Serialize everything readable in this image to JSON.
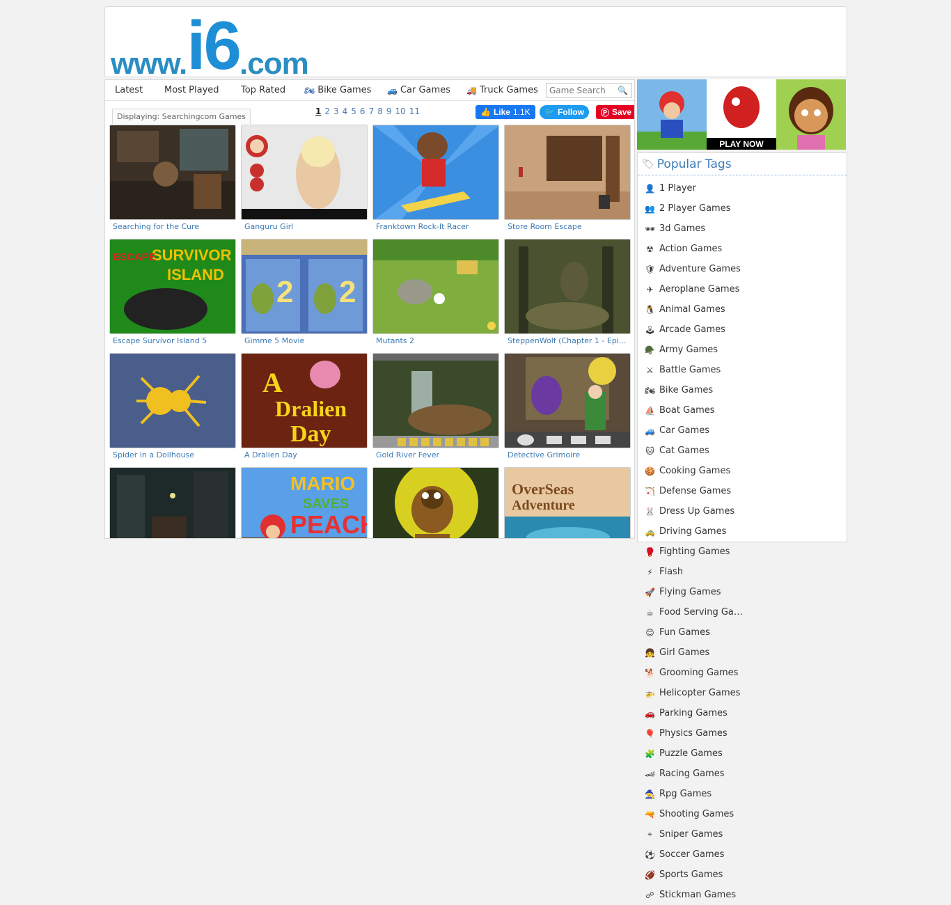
{
  "logo": {
    "www": "www.",
    "i6": "i6",
    "com": ".com"
  },
  "nav": {
    "latest": "Latest",
    "most_played": "Most Played",
    "top_rated": "Top Rated",
    "bike_games": "Bike Games",
    "car_games": "Car Games",
    "truck_games": "Truck Games",
    "search_placeholder": "Game Search"
  },
  "displaying": "Displaying: Searchingcom Games",
  "pager": [
    "1",
    "2",
    "3",
    "4",
    "5",
    "6",
    "7",
    "8",
    "9",
    "10",
    "11"
  ],
  "social": {
    "like": "Like",
    "like_count": "1.1K",
    "follow": "Follow",
    "save": "Save"
  },
  "games": [
    {
      "title": "Searching for the Cure"
    },
    {
      "title": "Ganguru Girl"
    },
    {
      "title": "Franktown Rock-It Racer"
    },
    {
      "title": "Store Room Escape"
    },
    {
      "title": "Escape Survivor Island 5"
    },
    {
      "title": "Gimme 5 Movie"
    },
    {
      "title": "Mutants 2"
    },
    {
      "title": "SteppenWolf (Chapter 1 - Epi..."
    },
    {
      "title": "Spider in a Dollhouse"
    },
    {
      "title": "A Dralien Day"
    },
    {
      "title": "Gold River Fever"
    },
    {
      "title": "Detective Grimoire"
    },
    {
      "title": ""
    },
    {
      "title": ""
    },
    {
      "title": ""
    },
    {
      "title": ""
    }
  ],
  "thumb_text": {
    "survivor": "SURVIVOR",
    "island": "ISLAND",
    "escape": "ESCAPE",
    "dralien_a": "A",
    "dralien_name": "Dralien",
    "dralien_day": "Day",
    "mario": "MARIO",
    "saves": "SAVES",
    "peach": "PEACH",
    "overseas": "OverSeas",
    "adventure": "Adventure",
    "play_now": "PLAY NOW"
  },
  "popular_tags": {
    "heading": "Popular Tags",
    "items": [
      {
        "label": "1 Player",
        "icon": "👤"
      },
      {
        "label": "2 Player Games",
        "icon": "👥"
      },
      {
        "label": "3d Games",
        "icon": "🕶"
      },
      {
        "label": "Action Games",
        "icon": "☢"
      },
      {
        "label": "Adventure Games",
        "icon": "🛡"
      },
      {
        "label": "Aeroplane Games",
        "icon": "✈"
      },
      {
        "label": "Animal Games",
        "icon": "🐧"
      },
      {
        "label": "Arcade Games",
        "icon": "🕹"
      },
      {
        "label": "Army Games",
        "icon": "🪖"
      },
      {
        "label": "Battle Games",
        "icon": "⚔"
      },
      {
        "label": "Bike Games",
        "icon": "🏍"
      },
      {
        "label": "Boat Games",
        "icon": "⛵"
      },
      {
        "label": "Car Games",
        "icon": "🚙"
      },
      {
        "label": "Cat Games",
        "icon": "🐱"
      },
      {
        "label": "Cooking Games",
        "icon": "🍪"
      },
      {
        "label": "Defense Games",
        "icon": "🏹"
      },
      {
        "label": "Dress Up Games",
        "icon": "🐰"
      },
      {
        "label": "Driving Games",
        "icon": "🚕"
      },
      {
        "label": "Fighting Games",
        "icon": "🥊"
      },
      {
        "label": "Flash",
        "icon": "⚡"
      },
      {
        "label": "Flying Games",
        "icon": "🚀"
      },
      {
        "label": "Food Serving Games",
        "icon": "☕"
      },
      {
        "label": "Fun Games",
        "icon": "😊"
      },
      {
        "label": "Girl Games",
        "icon": "👧"
      },
      {
        "label": "Grooming Games",
        "icon": "🐕"
      },
      {
        "label": "Helicopter Games",
        "icon": "🚁"
      },
      {
        "label": "Parking Games",
        "icon": "🚗"
      },
      {
        "label": "Physics Games",
        "icon": "🎈"
      },
      {
        "label": "Puzzle Games",
        "icon": "🧩"
      },
      {
        "label": "Racing Games",
        "icon": "🏎"
      },
      {
        "label": "Rpg Games",
        "icon": "🧙"
      },
      {
        "label": "Shooting Games",
        "icon": "🔫"
      },
      {
        "label": "Sniper Games",
        "icon": "⌖"
      },
      {
        "label": "Soccer Games",
        "icon": "⚽"
      },
      {
        "label": "Sports Games",
        "icon": "🏈"
      },
      {
        "label": "Stickman Games",
        "icon": "☍"
      }
    ]
  },
  "colors": {
    "link": "#3a7ab5",
    "logo": "#1e8fd6",
    "facebook": "#1877f2",
    "twitter": "#1d9bf0",
    "pinterest": "#e60023"
  }
}
